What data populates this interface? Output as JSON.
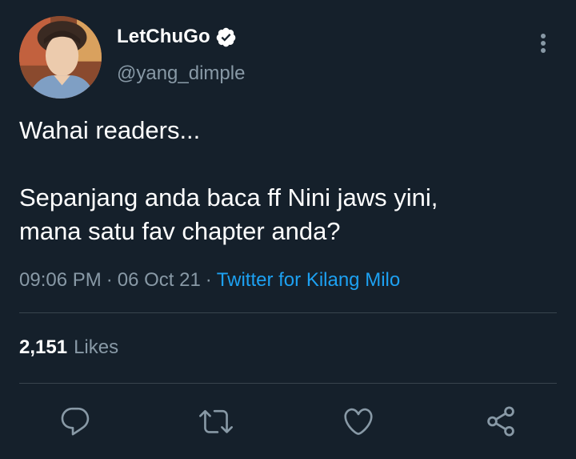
{
  "tweet": {
    "display_name": "LetChuGo",
    "handle": "@yang_dimple",
    "verified": true,
    "text_lines": [
      "Wahai readers...",
      "",
      "Sepanjang anda baca ff Nini jaws yini,",
      "mana satu fav chapter anda?"
    ],
    "time": "09:06 PM",
    "date": "06 Oct 21",
    "separator": "·",
    "source": "Twitter for Kilang Milo",
    "likes_count": "2,151",
    "likes_label": "Likes"
  },
  "icons": {
    "more": "more-vertical-icon",
    "verified": "verified-badge-icon",
    "reply": "reply-icon",
    "retweet": "retweet-icon",
    "like": "heart-icon",
    "share": "share-icon"
  },
  "colors": {
    "background": "#15202b",
    "text_primary": "#ffffff",
    "text_secondary": "#8899a6",
    "accent": "#1da1f2",
    "divider": "#38444d"
  }
}
